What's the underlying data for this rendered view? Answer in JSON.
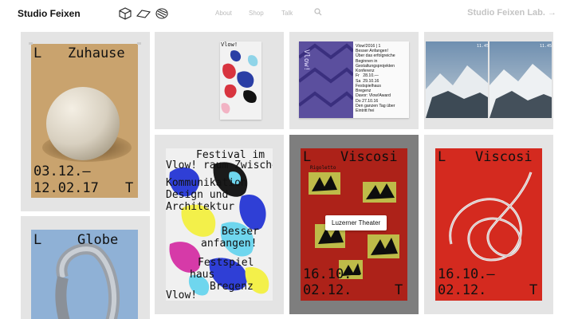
{
  "header": {
    "brand": "Studio Feixen",
    "icons": [
      "cube-icon",
      "plane-icon",
      "stack-icon"
    ],
    "nav": [
      "About",
      "Shop",
      "Talk"
    ],
    "lab_link": "Studio Feixen Lab. →"
  },
  "posters": {
    "zuhause": {
      "l": "L",
      "title": "Zuhause",
      "dates_1": "03.12.—",
      "dates_2": "12.02.17",
      "t": "T"
    },
    "globe": {
      "l": "L",
      "title": "Globe"
    },
    "vlow_open": {
      "text": "Vlow!"
    },
    "vlow_booklet": {
      "page_text": "Vlow!2016 | 1\nBesser Anfangen!\nÜber das erfolgreiche\nBeginnen in\nGestaltungsprojekten\nKonferenz\nFr   28.10.—\nSa  29.10.16\nFestspielhaus\nBregenz\nDavor: Vlow!Award\nDo 27.10.16\nDen ganzen Tag über\nEintritt frei",
      "spine_text": "Vlow!"
    },
    "brochure": {
      "time_1": "11.45",
      "time_2": "11.45"
    },
    "vlow_poster": {
      "lines": [
        "Festival im",
        "Vlow! raum Zwischen",
        "Kommunikation",
        "Design und",
        "Architektur",
        "Besser",
        "anfangen!",
        "Festspiel",
        "haus",
        "Bregenz",
        "Vlow!"
      ]
    },
    "viscosi_red": {
      "l": "L",
      "title": "Viscosi",
      "dates_1": "16.10.—",
      "dates_2": "02.12.",
      "t": "T",
      "small": "Rigoletto",
      "tooltip": "Luzerner Theater"
    },
    "viscosi_line": {
      "l": "L",
      "title": "Viscosi",
      "dates_1": "16.10.—",
      "dates_2": "02.12.",
      "t": "T"
    }
  },
  "colors": {
    "tan": "#c9a36e",
    "blue": "#8fb1d6",
    "red": "#d42a1f",
    "yellow": "#e8e55a",
    "tile": "#e4e4e4"
  }
}
